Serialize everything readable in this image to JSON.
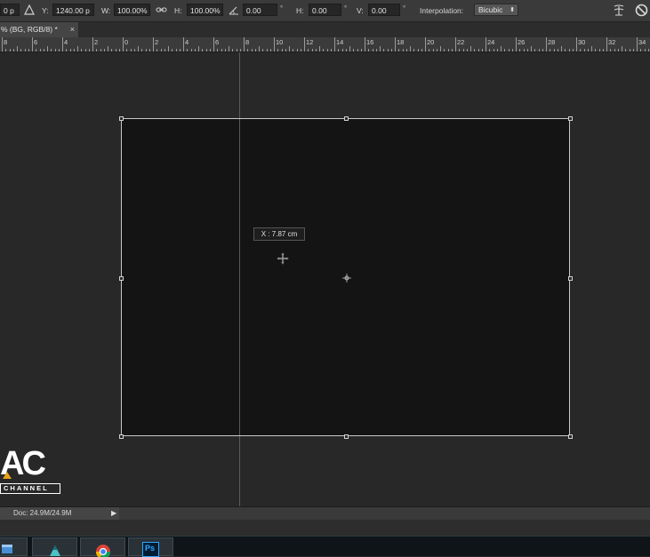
{
  "options_bar": {
    "x_value": "0 p",
    "y_label": "Y:",
    "y_value": "1240.00 p",
    "w_label": "W:",
    "w_value": "100.00%",
    "h_label": "H:",
    "h_value": "100.00%",
    "angle_value": "0.00",
    "degree_symbol": "°",
    "hskew_label": "H:",
    "hskew_value": "0.00",
    "vskew_label": "V:",
    "vskew_value": "0.00",
    "interpolation_label": "Interpolation:",
    "interpolation_value": "Bicubic"
  },
  "document_tab": {
    "title": "% (BG, RGB/8) *",
    "close": "×"
  },
  "ruler": {
    "numbers": [
      "8",
      "6",
      "4",
      "2",
      "0",
      "2",
      "4",
      "6",
      "8",
      "10",
      "12",
      "14",
      "16",
      "18",
      "20",
      "22",
      "24",
      "26",
      "28",
      "30",
      "32",
      "34"
    ]
  },
  "canvas": {
    "tooltip": "X :  7.87 cm"
  },
  "logo": {
    "text": "AC",
    "subtext": "CHANNEL"
  },
  "status_bar": {
    "doc_info": "Doc: 24.9M/24.9M",
    "arrow": "▶"
  },
  "taskbar": {
    "ps_label": "Ps"
  },
  "colors": {
    "canvas_bg": "#282828",
    "document": "#141414",
    "panel": "#3a3a3a"
  }
}
